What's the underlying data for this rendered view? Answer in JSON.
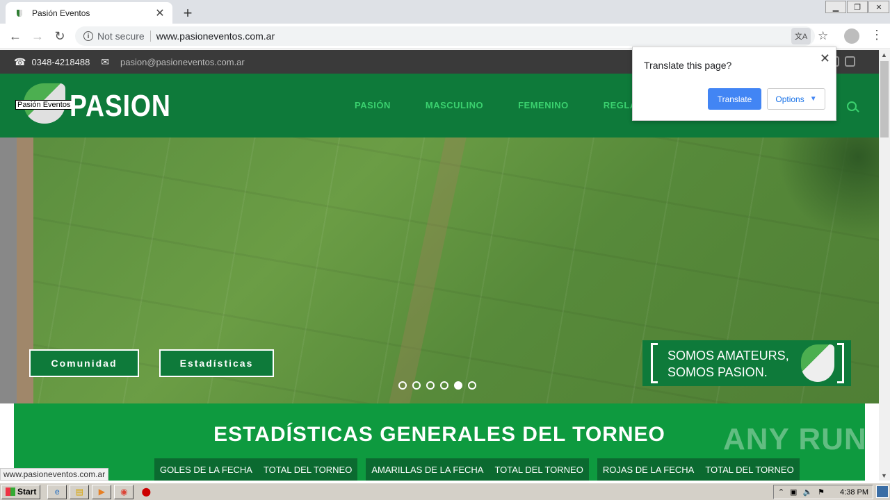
{
  "browser": {
    "tab_title": "Pasión Eventos",
    "new_tab": "+",
    "security": "Not secure",
    "url": "www.pasioneventos.com.ar",
    "status_url": "www.pasioneventos.com.ar"
  },
  "translate_popup": {
    "title": "Translate this page?",
    "translate_label": "Translate",
    "options_label": "Options"
  },
  "site": {
    "phone": "0348-4218488",
    "email": "pasion@pasioneventos.com.ar",
    "logo_tooltip": "Pasión Eventos",
    "logo_text": "PASION",
    "nav": [
      "PASIÓN",
      "MASCULINO",
      "FEMENINO",
      "REGLAMEN"
    ],
    "hero_buttons": [
      "Comunidad",
      "Estadísticas"
    ],
    "slogan_line1": "SOMOS AMATEURS,",
    "slogan_line2": "SOMOS PASION.",
    "slider_active_index": 4,
    "stats_title": "ESTADÍSTICAS GENERALES DEL TORNEO",
    "stats_tabs": [
      [
        "GOLES DE LA FECHA",
        "TOTAL DEL TORNEO"
      ],
      [
        "AMARILLAS DE LA FECHA",
        "TOTAL DEL TORNEO"
      ],
      [
        "ROJAS DE LA FECHA",
        "TOTAL DEL TORNEO"
      ]
    ]
  },
  "watermark": "ANY RUN",
  "taskbar": {
    "start": "Start",
    "clock": "4:38 PM"
  },
  "colors": {
    "brand_green": "#0e7a3a",
    "nav_green": "#3bd16f",
    "stats_green": "#0e9a3f",
    "chrome_blue": "#4285f4"
  }
}
